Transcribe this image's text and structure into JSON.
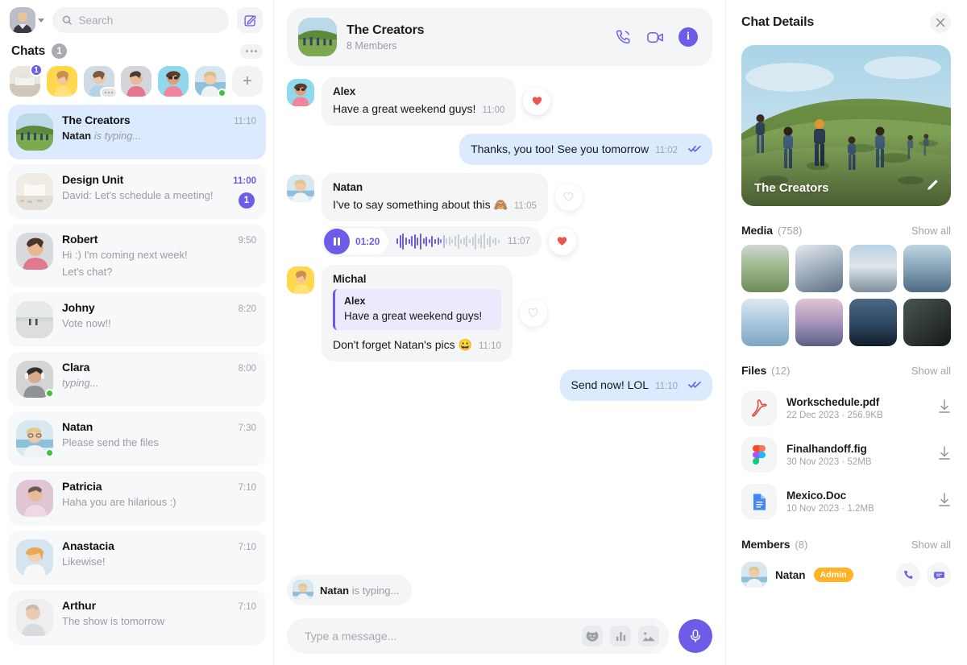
{
  "colors": {
    "accent": "#6C5CE8",
    "outgoing_bubble": "#DBEAFE",
    "incoming_bubble": "#F4F5F7",
    "online": "#3EC13E",
    "admin_badge": "#FFB224",
    "heart": "#E8564F"
  },
  "sidebar": {
    "search": {
      "placeholder": "Search",
      "value": ""
    },
    "compose_icon": "compose-icon",
    "chats_label": "Chats",
    "chats_count": "1",
    "more_icon": "more-dots-icon",
    "stories": [
      {
        "name": "story-1",
        "badge": "1",
        "state": "unread"
      },
      {
        "name": "story-2",
        "state": "none"
      },
      {
        "name": "story-3",
        "state": "typing"
      },
      {
        "name": "story-4",
        "state": "none"
      },
      {
        "name": "story-5",
        "state": "none"
      },
      {
        "name": "story-6",
        "state": "online"
      }
    ],
    "add_story_label": "+",
    "items": [
      {
        "name": "The Creators",
        "preview": "Natan is typing...",
        "preview_bold": "Natan",
        "time": "11:10",
        "active": true,
        "badge": null,
        "online": false,
        "italic": true
      },
      {
        "name": "Design Unit",
        "preview": "David: Let's schedule a meeting!",
        "time": "11:00",
        "active": false,
        "badge": "1",
        "online": false,
        "italic": false
      },
      {
        "name": "Robert",
        "preview": "Hi :) I'm coming next week!",
        "preview2": "Let's chat?",
        "time": "9:50",
        "active": false,
        "badge": null,
        "online": false,
        "italic": false
      },
      {
        "name": "Johny",
        "preview": "Vote now!!",
        "time": "8:20",
        "active": false,
        "badge": null,
        "online": false,
        "italic": false
      },
      {
        "name": "Clara",
        "preview": "typing...",
        "time": "8:00",
        "active": false,
        "badge": null,
        "online": true,
        "italic": true
      },
      {
        "name": "Natan",
        "preview": "Please send the files",
        "time": "7:30",
        "active": false,
        "badge": null,
        "online": true,
        "italic": false
      },
      {
        "name": "Patricia",
        "preview": "Haha you are hilarious :)",
        "time": "7:10",
        "active": false,
        "badge": null,
        "online": false,
        "italic": false
      },
      {
        "name": "Anastacia",
        "preview": "Likewise!",
        "time": "7:10",
        "active": false,
        "badge": null,
        "online": false,
        "italic": false
      },
      {
        "name": "Arthur",
        "preview": "The show is tomorrow",
        "time": "7:10",
        "active": false,
        "badge": null,
        "online": false,
        "italic": false
      }
    ]
  },
  "conversation": {
    "header": {
      "title": "The Creators",
      "subtitle": "8 Members",
      "call_icon": "phone-call-icon",
      "video_icon": "video-camera-icon",
      "info_icon": "info-icon",
      "info_label": "i"
    },
    "messages": [
      {
        "kind": "incoming-text",
        "sender": "Alex",
        "text": "Have a great weekend guys!",
        "time": "11:00",
        "reaction": "heart-filled"
      },
      {
        "kind": "outgoing-text",
        "text": "Thanks, you too! See you tomorrow",
        "time": "11:02",
        "status": "read"
      },
      {
        "kind": "incoming-text",
        "sender": "Natan",
        "text": "I've to say something about this 🙈",
        "time": "11:05",
        "reaction": "heart-empty"
      },
      {
        "kind": "voice",
        "duration": "01:20",
        "time": "11:07",
        "reaction": "heart-filled",
        "play_state": "pause"
      },
      {
        "kind": "incoming-quote",
        "sender": "Michal",
        "quote_name": "Alex",
        "quote_text": "Have a great weekend guys!",
        "text": "Don't forget Natan's pics 😀",
        "time": "11:10",
        "reaction": "heart-empty"
      },
      {
        "kind": "outgoing-text",
        "text": "Send now! LOL",
        "time": "11:10",
        "status": "read"
      }
    ],
    "typing": {
      "name": "Natan",
      "suffix": " is typing..."
    },
    "composer": {
      "placeholder": "Type a message...",
      "value": "",
      "sticker_icon": "sticker-cat-icon",
      "poll_icon": "poll-bars-icon",
      "image_icon": "image-icon",
      "mic_icon": "microphone-icon"
    }
  },
  "details": {
    "title": "Chat Details",
    "close_icon": "close-icon",
    "hero": {
      "name": "The Creators",
      "edit_icon": "pencil-edit-icon"
    },
    "media": {
      "title": "Media",
      "count": "(758)",
      "show_all": "Show all",
      "thumbs": 8
    },
    "files": {
      "title": "Files",
      "count": "(12)",
      "show_all": "Show all",
      "items": [
        {
          "name": "Workschedule.pdf",
          "date": "22 Dec 2023",
          "size": "256.9KB",
          "icon": "pdf-file-icon",
          "download_icon": "download-icon"
        },
        {
          "name": "Finalhandoff.fig",
          "date": "30 Nov 2023",
          "size": "52MB",
          "icon": "figma-file-icon",
          "download_icon": "download-icon"
        },
        {
          "name": "Mexico.Doc",
          "date": "10 Nov 2023",
          "size": "1.2MB",
          "icon": "doc-file-icon",
          "download_icon": "download-icon"
        }
      ]
    },
    "members": {
      "title": "Members",
      "count": "(8)",
      "show_all": "Show all",
      "items": [
        {
          "name": "Natan",
          "role": "Admin",
          "call_icon": "phone-icon",
          "message_icon": "message-icon"
        }
      ]
    }
  }
}
